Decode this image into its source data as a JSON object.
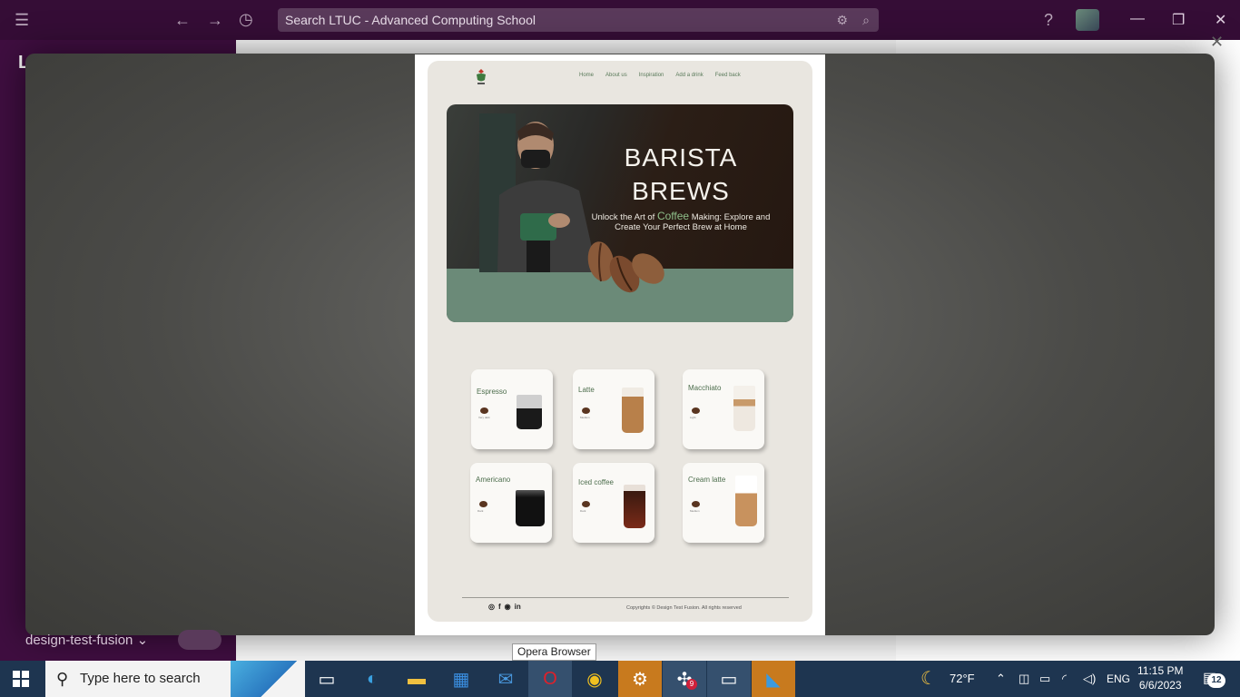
{
  "slack": {
    "search_placeholder": "Search LTUC - Advanced Computing School",
    "workspace_name": "design-test-fusion",
    "workspace_letter": "L",
    "close_label": "✕"
  },
  "site": {
    "nav": [
      "Home",
      "About us",
      "Inspiration",
      "Add a drink",
      "Feed back"
    ],
    "hero_title_line1": "BARISTA",
    "hero_title_line2": "BREWS",
    "hero_sub_part1": "Unlock the Art of ",
    "hero_sub_coffee": "Coffee",
    "hero_sub_part2": " Making: Explore and Create Your Perfect Brew at Home",
    "drinks": [
      {
        "name": "Espresso",
        "note": "Very dark"
      },
      {
        "name": "Latte",
        "note": "Medium"
      },
      {
        "name": "Macchiato",
        "note": "Light"
      },
      {
        "name": "Americano",
        "note": "Dark"
      },
      {
        "name": "Iced coffee",
        "note": "Dark"
      },
      {
        "name": "Cream latte",
        "note": "Medium"
      }
    ],
    "socials": [
      "◎",
      "f",
      "◉",
      "in"
    ],
    "copyright": "Copyrights © Design Test Fusion. All rights reserved"
  },
  "tooltip": "Opera Browser",
  "taskbar": {
    "search_placeholder": "Type here to search",
    "weather": "72°F",
    "language": "ENG",
    "time": "11:15 PM",
    "date": "6/6/2023",
    "notifications": "12",
    "slack_badge": "9"
  },
  "colors": {
    "slack_purple": "#350d36",
    "site_bg": "#e9e6e0",
    "accent_green": "#6b8a78",
    "taskbar": "#1e3550"
  }
}
